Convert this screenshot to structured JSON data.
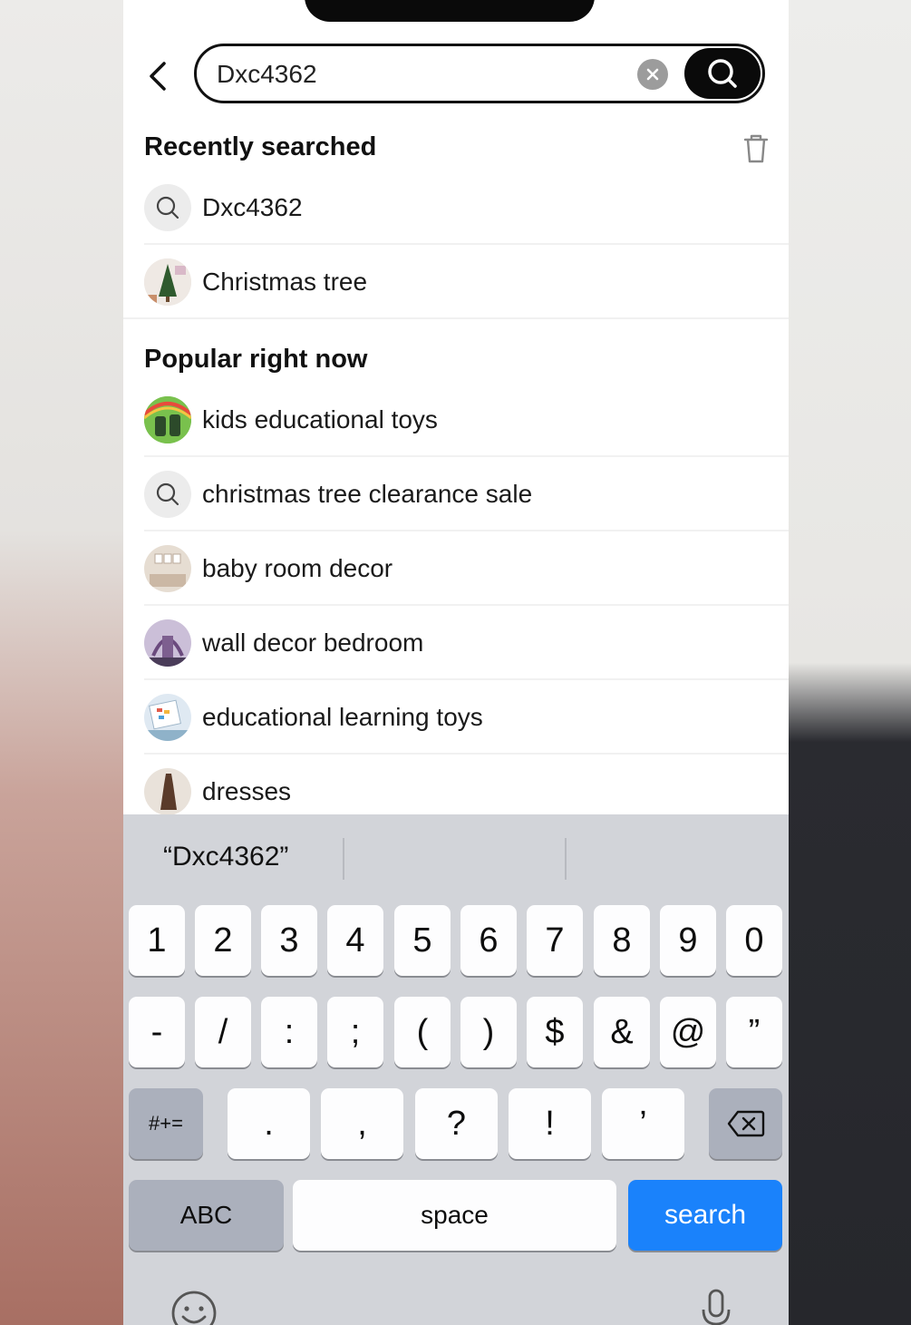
{
  "search": {
    "value": "Dxc4362"
  },
  "recent": {
    "title": "Recently searched",
    "items": [
      {
        "label": "Dxc4362",
        "thumb": "search-icon"
      },
      {
        "label": "Christmas tree",
        "thumb": "christmas-tree-image"
      }
    ]
  },
  "popular": {
    "title": "Popular right now",
    "items": [
      {
        "label": "kids educational toys",
        "thumb": "toys-image"
      },
      {
        "label": "christmas tree clearance sale",
        "thumb": "search-icon"
      },
      {
        "label": "baby room decor",
        "thumb": "room-image"
      },
      {
        "label": "wall decor bedroom",
        "thumb": "wall-decor-image"
      },
      {
        "label": "educational learning toys",
        "thumb": "learning-toys-image"
      },
      {
        "label": "dresses",
        "thumb": "dress-image"
      }
    ]
  },
  "keyboard": {
    "suggestion": "“Dxc4362”",
    "row1": [
      "1",
      "2",
      "3",
      "4",
      "5",
      "6",
      "7",
      "8",
      "9",
      "0"
    ],
    "row2": [
      "-",
      "/",
      ":",
      ";",
      "(",
      ")",
      "$",
      "&",
      "@",
      "”"
    ],
    "row3_left": "#+=",
    "row3": [
      ".",
      ",",
      "?",
      "!",
      "’"
    ],
    "abc": "ABC",
    "space": "space",
    "search": "search"
  },
  "colors": {
    "search_key": "#1a82fb",
    "keyboard_bg": "#d2d4d9"
  }
}
